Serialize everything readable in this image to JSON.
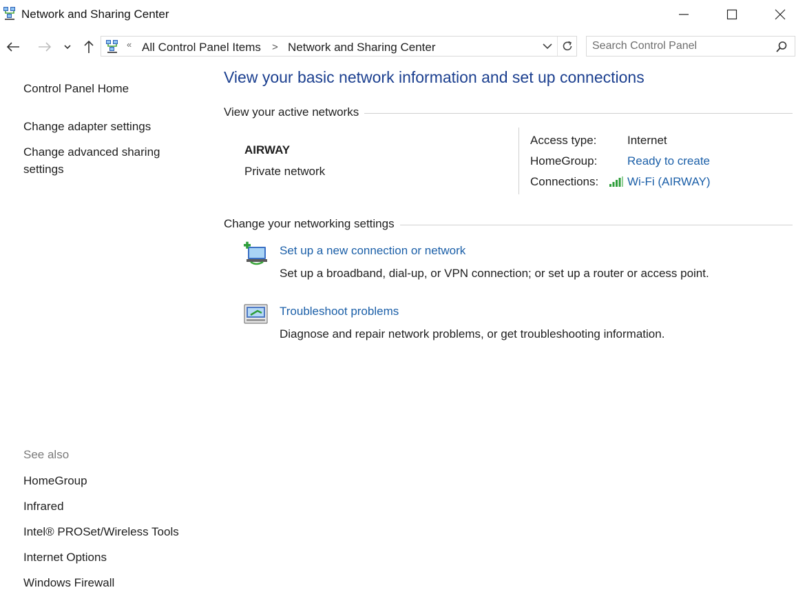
{
  "window": {
    "title": "Network and Sharing Center",
    "icon": "network-control-panel-icon",
    "controls": [
      "minimize-icon",
      "maximize-icon",
      "close-icon"
    ]
  },
  "address": {
    "overflow": "«",
    "breadcrumbs": [
      "All Control Panel Items",
      "Network and Sharing Center"
    ],
    "separator": ">",
    "search_placeholder": "Search Control Panel"
  },
  "sidebar": {
    "home": "Control Panel Home",
    "links": [
      "Change adapter settings",
      "Change advanced sharing settings"
    ],
    "see_also_heading": "See also",
    "see_also": [
      "HomeGroup",
      "Infrared",
      "Intel® PROSet/Wireless Tools",
      "Internet Options",
      "Windows Firewall"
    ]
  },
  "main": {
    "title": "View your basic network information and set up connections",
    "active_networks_heading": "View your active networks",
    "network": {
      "name": "AIRWAY",
      "category": "Private network",
      "access_type_label": "Access type:",
      "access_type_value": "Internet",
      "homegroup_label": "HomeGroup:",
      "homegroup_value": "Ready to create",
      "connections_label": "Connections:",
      "connections_value": "Wi-Fi (AIRWAY)"
    },
    "settings_heading": "Change your networking settings",
    "tasks": [
      {
        "icon": "new-connection-icon",
        "title": "Set up a new connection or network",
        "description": "Set up a broadband, dial-up, or VPN connection; or set up a router or access point."
      },
      {
        "icon": "troubleshoot-icon",
        "title": "Troubleshoot problems",
        "description": "Diagnose and repair network problems, or get troubleshooting information."
      }
    ]
  },
  "colors": {
    "link": "#1b5fa8",
    "title": "#1b3f8f",
    "muted": "#7a7a7a",
    "signal": "#2e9e3a"
  }
}
